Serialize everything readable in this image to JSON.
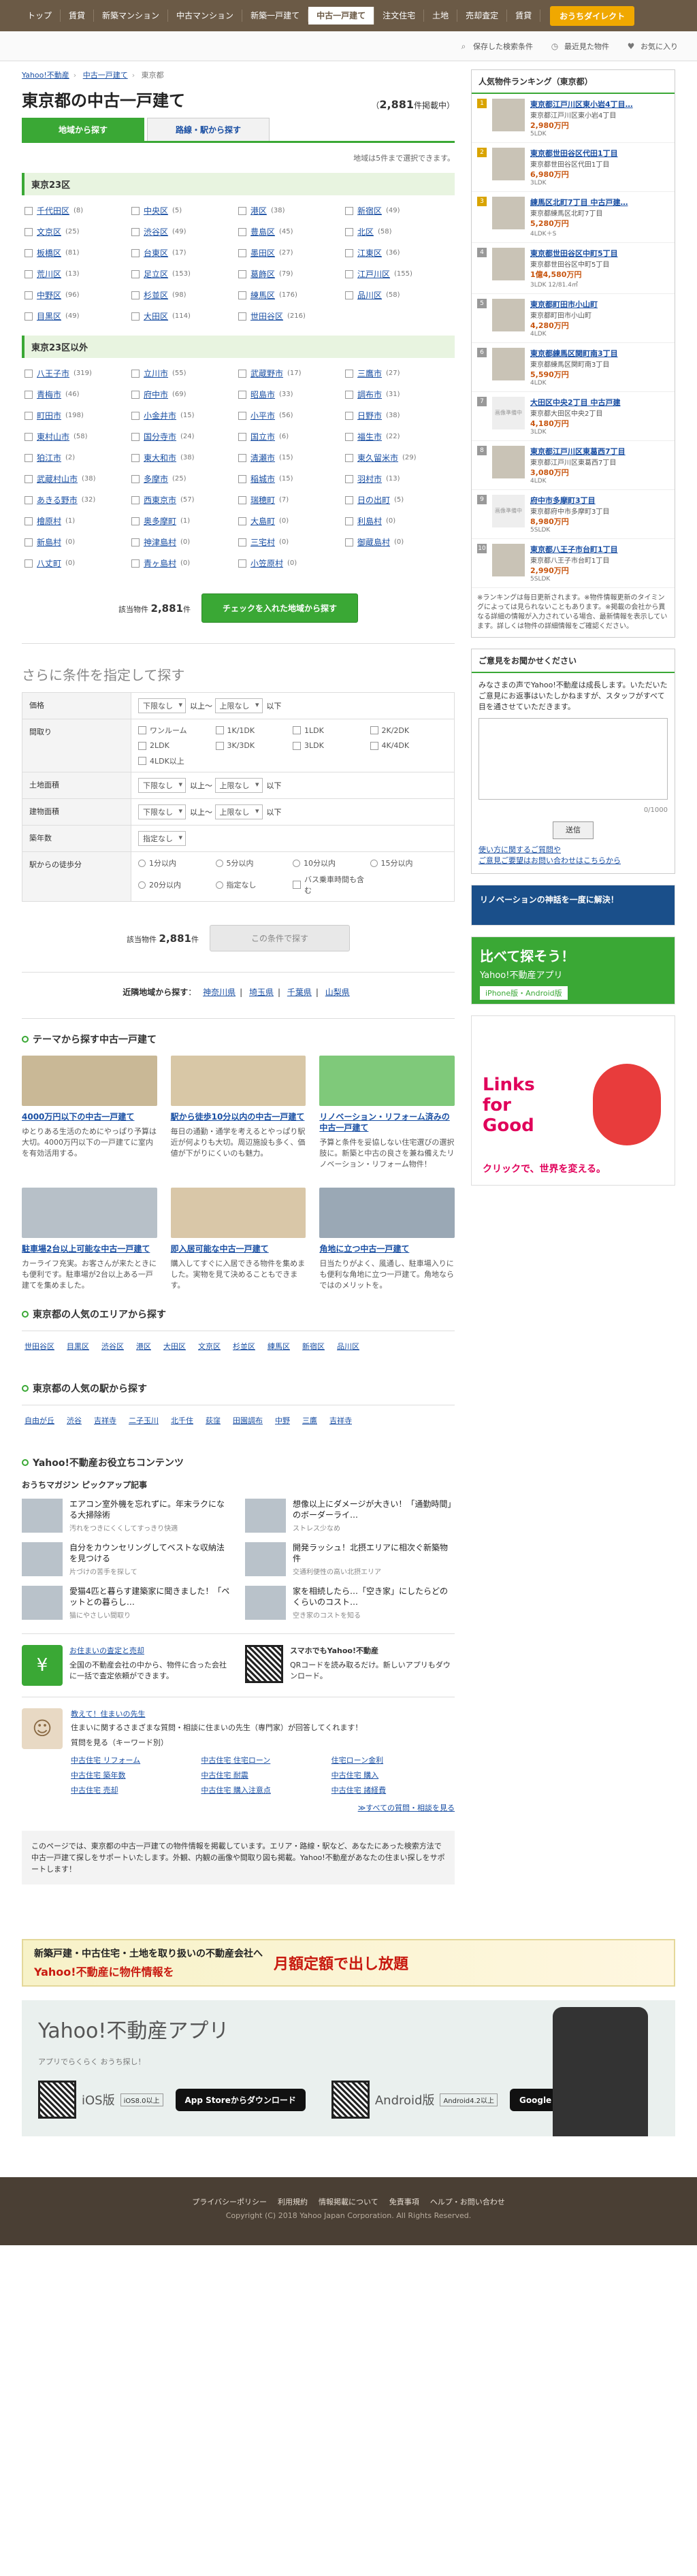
{
  "nav": {
    "items": [
      "トップ",
      "賃貸",
      "新築マンション",
      "中古マンション",
      "新築一戸建て",
      "中古一戸建て",
      "注文住宅",
      "土地",
      "売却査定",
      "賃貸"
    ],
    "active_index": 5,
    "direct": "おうちダイレクト"
  },
  "subbar": {
    "saved": "保存した検索条件",
    "history": "最近見た物件",
    "fav": "お気に入り"
  },
  "breadcrumb": [
    "Yahoo!不動産",
    "中古一戸建て",
    "東京都"
  ],
  "page": {
    "title": "東京都の中古一戸建て",
    "count": "2,881",
    "count_unit": "件掲載中"
  },
  "tabs": [
    "地域から探す",
    "路線・駅から探す"
  ],
  "hint": "地域は5件まで選択できます。",
  "section23": "東京23区",
  "areas23": [
    [
      "千代田区",
      "(8)"
    ],
    [
      "中央区",
      "(5)"
    ],
    [
      "港区",
      "(38)"
    ],
    [
      "新宿区",
      "(49)"
    ],
    [
      "文京区",
      "(25)"
    ],
    [
      "渋谷区",
      "(49)"
    ],
    [
      "豊島区",
      "(45)"
    ],
    [
      "北区",
      "(58)"
    ],
    [
      "板橋区",
      "(81)"
    ],
    [
      "台東区",
      "(17)"
    ],
    [
      "墨田区",
      "(27)"
    ],
    [
      "江東区",
      "(36)"
    ],
    [
      "荒川区",
      "(13)"
    ],
    [
      "足立区",
      "(153)"
    ],
    [
      "葛飾区",
      "(79)"
    ],
    [
      "江戸川区",
      "(155)"
    ],
    [
      "中野区",
      "(96)"
    ],
    [
      "杉並区",
      "(98)"
    ],
    [
      "練馬区",
      "(176)"
    ],
    [
      "品川区",
      "(58)"
    ],
    [
      "目黒区",
      "(49)"
    ],
    [
      "大田区",
      "(114)"
    ],
    [
      "世田谷区",
      "(216)"
    ],
    [
      "",
      ""
    ]
  ],
  "sectionOther": "東京23区以外",
  "areasOther": [
    [
      "八王子市",
      "(319)"
    ],
    [
      "立川市",
      "(55)"
    ],
    [
      "武蔵野市",
      "(17)"
    ],
    [
      "三鷹市",
      "(27)"
    ],
    [
      "青梅市",
      "(46)"
    ],
    [
      "府中市",
      "(69)"
    ],
    [
      "昭島市",
      "(33)"
    ],
    [
      "調布市",
      "(31)"
    ],
    [
      "町田市",
      "(198)"
    ],
    [
      "小金井市",
      "(15)"
    ],
    [
      "小平市",
      "(56)"
    ],
    [
      "日野市",
      "(38)"
    ],
    [
      "東村山市",
      "(58)"
    ],
    [
      "国分寺市",
      "(24)"
    ],
    [
      "国立市",
      "(6)"
    ],
    [
      "福生市",
      "(22)"
    ],
    [
      "狛江市",
      "(2)"
    ],
    [
      "東大和市",
      "(38)"
    ],
    [
      "清瀬市",
      "(15)"
    ],
    [
      "東久留米市",
      "(29)"
    ],
    [
      "武蔵村山市",
      "(38)"
    ],
    [
      "多摩市",
      "(25)"
    ],
    [
      "稲城市",
      "(15)"
    ],
    [
      "羽村市",
      "(13)"
    ],
    [
      "あきる野市",
      "(32)"
    ],
    [
      "西東京市",
      "(57)"
    ],
    [
      "瑞穂町",
      "(7)"
    ],
    [
      "日の出町",
      "(5)"
    ],
    [
      "檜原村",
      "(1)"
    ],
    [
      "奥多摩町",
      "(1)"
    ],
    [
      "大島町",
      "(0)"
    ],
    [
      "利島村",
      "(0)"
    ],
    [
      "新島村",
      "(0)"
    ],
    [
      "神津島村",
      "(0)"
    ],
    [
      "三宅村",
      "(0)"
    ],
    [
      "御蔵島村",
      "(0)"
    ],
    [
      "八丈町",
      "(0)"
    ],
    [
      "青ヶ島村",
      "(0)"
    ],
    [
      "小笠原村",
      "(0)"
    ],
    [
      "",
      ""
    ]
  ],
  "submit": {
    "label": "該当物件",
    "count": "2,881",
    "unit": "件",
    "button": "チェックを入れた地域から探す"
  },
  "filter": {
    "title": "さらに条件を指定して探す",
    "rows": [
      "価格",
      "間取り",
      "土地面積",
      "建物面積",
      "築年数",
      "駅からの徒歩分"
    ],
    "lower": "下限なし",
    "upper": "上限なし",
    "ijo": "以上～",
    "ika": "以下",
    "madori": [
      "ワンルーム",
      "1K/1DK",
      "1LDK",
      "2K/2DK",
      "2LDK",
      "3K/3DK",
      "3LDK",
      "4K/4DK",
      "4LDK以上"
    ],
    "walk": [
      "1分以内",
      "5分以内",
      "10分以内",
      "15分以内",
      "20分以内",
      "指定なし",
      "バス乗車時間も含む"
    ],
    "nochoice": "指定なし",
    "button": "この条件で探す"
  },
  "nearby": {
    "label": "近隣地域から探す",
    "links": [
      "神奈川県",
      "埼玉県",
      "千葉県",
      "山梨県"
    ]
  },
  "themes": {
    "title": "テーマから探す中古一戸建て",
    "items": [
      {
        "t": "4000万円以下の中古一戸建て",
        "d": "ゆとりある生活のためにやっぱり予算は大切。4000万円以下の一戸建てに室内を有効活用する。"
      },
      {
        "t": "駅から徒歩10分以内の中古一戸建て",
        "d": "毎日の通勤・通学を考えるとやっぱり駅近が何よりも大切。周辺施設も多く、価値が下がりにくいのも魅力。"
      },
      {
        "t": "リノベーション・リフォーム済みの中古一戸建て",
        "d": "予算と条件を妥協しない住宅選びの選択肢に。新築と中古の良さを兼ね備えたリノベーション・リフォーム物件！"
      },
      {
        "t": "駐車場2台以上可能な中古一戸建て",
        "d": "カーライフ充実。お客さんが来たときにも便利です。駐車場が2台以上ある一戸建てを集めました。"
      },
      {
        "t": "即入居可能な中古一戸建て",
        "d": "購入してすぐに入居できる物件を集めました。実物を見て決めることもできます。"
      },
      {
        "t": "角地に立つ中古一戸建て",
        "d": "日当たりがよく、風通し、駐車場入りにも便利な角地に立つ一戸建て。角地ならではのメリットを。"
      }
    ]
  },
  "popularAreas": {
    "title": "東京都の人気のエリアから探す",
    "links": [
      "世田谷区",
      "目黒区",
      "渋谷区",
      "港区",
      "大田区",
      "文京区",
      "杉並区",
      "練馬区",
      "新宿区",
      "品川区"
    ]
  },
  "popularStations": {
    "title": "東京都の人気の駅から探す",
    "links": [
      "自由が丘",
      "渋谷",
      "吉祥寺",
      "二子玉川",
      "北千住",
      "荻窪",
      "田園調布",
      "中野",
      "三鷹",
      "吉祥寺"
    ]
  },
  "contents": {
    "title": "Yahoo!不動産お役立ちコンテンツ",
    "magazine": "おうちマガジン ピックアップ記事"
  },
  "magazine": [
    {
      "t": "エアコン室外機を忘れずに。年末ラクになる大掃除術",
      "s": "汚れをつきにくくしてすっきり快適"
    },
    {
      "t": "想像以上にダメージが大きい！「通勤時間」のボーダーライ…",
      "s": "ストレス少なめ"
    },
    {
      "t": "自分をカウンセリングしてベストな収納法を見つける",
      "s": "片づけの苦手を探して"
    },
    {
      "t": "開発ラッシュ！北摂エリアに相次ぐ新築物件",
      "s": "交通利便性の高い北摂エリア"
    },
    {
      "t": "愛猫4匹と暮らす建築家に聞きました！「ペットとの暮らし…",
      "s": "猫にやさしい間取り"
    },
    {
      "t": "家を相続したら…「空き家」にしたらどのくらいのコスト…",
      "s": "空き家のコストを知る"
    }
  ],
  "promo": {
    "t1": "お住まいの査定と売却",
    "d1": "全国の不動産会社の中から、物件に合った会社に一括で査定依頼ができます。",
    "t2": "スマホでもYahoo!不動産",
    "d2": "QRコードを読み取るだけ。新しいアプリもダウンロード。",
    "qa_t": "教えて！住まいの先生",
    "qa_d": "住まいに関するさまざまな質問・相談に住まいの先生（専門家）が回答してくれます！",
    "qa_sub": "質問を見る（キーワード別）",
    "qa_links": [
      "中古住宅 リフォーム",
      "中古住宅 住宅ローン",
      "住宅ローン金利",
      "中古住宅 築年数",
      "中古住宅 耐震",
      "中古住宅 購入",
      "中古住宅 売却",
      "中古住宅 購入注意点",
      "中古住宅 諸経費"
    ],
    "qa_more": "≫すべての質問・相談を見る"
  },
  "note": "このページでは、東京都の中古一戸建ての物件情報を掲載しています。エリア・路線・駅など、あなたにあった検索方法で中古一戸建て探しをサポートいたします。外観、内観の画像や間取り図も掲載。Yahoo!不動産があなたの住まい探しをサポートします！",
  "banner1": {
    "a": "新築戸建・中古住宅・土地を取り扱いの不動産会社へ",
    "b": "Yahoo!不動産に物件情報を",
    "c": "月額定額で出し放題"
  },
  "banner2": {
    "app": "Yahoo!不動産アプリ",
    "ios": "iOS版",
    "ios_ver": "iOS8.0以上",
    "android": "Android版",
    "android_ver": "Android4.2以上",
    "appstore": "App Storeからダウンロード",
    "gplay": "Google Play で手に入れよう",
    "tagline": "アプリでらくらく おうち探し！"
  },
  "footer": {
    "links": [
      "プライバシーポリシー",
      "利用規約",
      "情報掲載について",
      "免責事項",
      "ヘルプ・お問い合わせ"
    ],
    "copy": "Copyright (C) 2018 Yahoo Japan Corporation. All Rights Reserved."
  },
  "ranking": {
    "title": "人気物件ランキング（東京都）",
    "items": [
      {
        "n": "1",
        "t": "東京都江戸川区東小岩4丁目…",
        "a": "東京都江戸川区東小岩4丁目",
        "p": "2,980万円",
        "s": "5LDK"
      },
      {
        "n": "2",
        "t": "東京都世田谷区代田1丁目",
        "a": "東京都世田谷区代田1丁目",
        "p": "6,980万円",
        "s": "3LDK"
      },
      {
        "n": "3",
        "t": "練馬区北町7丁目 中古戸建…",
        "a": "東京都練馬区北町7丁目",
        "p": "5,280万円",
        "s": "4LDK＋S"
      },
      {
        "n": "4",
        "t": "東京都世田谷区中町5丁目",
        "a": "東京都世田谷区中町5丁目",
        "p": "1億4,580万円",
        "s": "3LDK 12/81.4㎡"
      },
      {
        "n": "5",
        "t": "東京都町田市小山町",
        "a": "東京都町田市小山町",
        "p": "4,280万円",
        "s": "4LDK"
      },
      {
        "n": "6",
        "t": "東京都練馬区関町南3丁目",
        "a": "東京都練馬区関町南3丁目",
        "p": "5,590万円",
        "s": "4LDK"
      },
      {
        "n": "7",
        "t": "大田区中央2丁目 中古戸建",
        "a": "東京都大田区中央2丁目",
        "p": "4,180万円",
        "s": "3LDK"
      },
      {
        "n": "8",
        "t": "東京都江戸川区東葛西7丁目",
        "a": "東京都江戸川区東葛西7丁目",
        "p": "3,080万円",
        "s": "4LDK"
      },
      {
        "n": "9",
        "t": "府中市多摩町3丁目",
        "a": "東京都府中市多摩町3丁目",
        "p": "8,980万円",
        "s": "5SLDK"
      },
      {
        "n": "10",
        "t": "東京都八王子市台町1丁目",
        "a": "東京都八王子市台町1丁目",
        "p": "2,990万円",
        "s": "5SLDK"
      }
    ],
    "noimg": "画像準備中",
    "note": "※ランキングは毎日更新されます。※物件情報更新のタイミングによっては見られないこともあります。※掲載の会社から異なる詳細の情報が入力されている場合、最新情報を表示しています。詳しくは物件の詳細情報をご確認ください。"
  },
  "feedback": {
    "title": "ご意見をお聞かせください",
    "desc": "みなさまの声でYahoo!不動産は成長します。いただいたご意見にお返事はいたしかねますが、スタッフがすべて目を通させていただきます。",
    "counter": "0/1000",
    "send": "送信",
    "link1": "使い方に関するご質問や",
    "link2": "ご意見ご要望はお問い合わせはこちらから"
  },
  "ads": {
    "reno": "リノベーションの神話を一度に解決！",
    "app": "比べて探そう！",
    "app_sub": "Yahoo!不動産アプリ",
    "app_os": "iPhone版・Android版",
    "links": "Links for Good",
    "links_sub": "クリックで、世界を変える。"
  }
}
